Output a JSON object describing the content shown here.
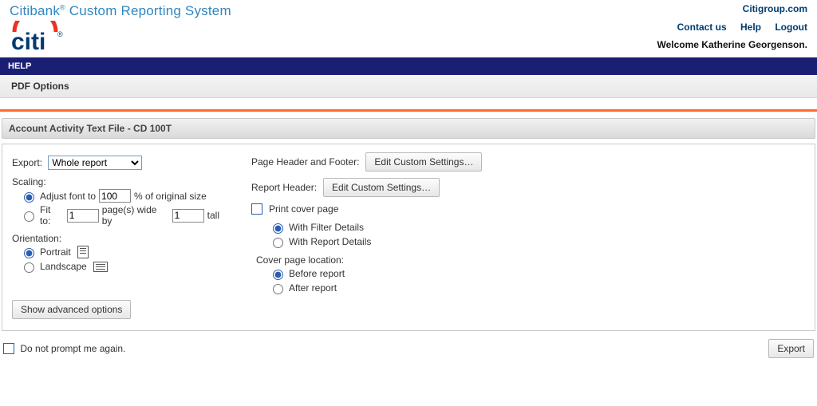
{
  "header": {
    "brand_title_1": "Citibank",
    "brand_reg": "®",
    "brand_title_2": " Custom Reporting System",
    "citi_link": "Citigroup.com",
    "nav_contact": "Contact us",
    "nav_help": "Help",
    "nav_logout": "Logout",
    "welcome": "Welcome Katherine Georgenson."
  },
  "help_bar": "HELP",
  "sub_bar": "PDF Options",
  "section_title": "Account Activity Text File - CD 100T",
  "left": {
    "export_label": "Export:",
    "export_value": "Whole report",
    "scaling_label": "Scaling:",
    "adjust_font_label_pre": "Adjust font to",
    "adjust_font_value": "100",
    "adjust_font_label_post": "% of original size",
    "fit_to_label": "Fit to:",
    "fit_pages_value": "1",
    "fit_pages_mid": "page(s) wide by",
    "fit_tall_value": "1",
    "fit_tall_post": "tall",
    "orientation_label": "Orientation:",
    "portrait_label": "Portrait",
    "landscape_label": "Landscape",
    "show_advanced": "Show advanced options"
  },
  "right": {
    "phf_label": "Page Header and Footer:",
    "edit_custom": "Edit Custom Settings…",
    "rh_label": "Report Header:",
    "print_cover": "Print cover page",
    "with_filter": "With Filter Details",
    "with_report": "With Report Details",
    "cover_loc_label": "Cover page location:",
    "before_report": "Before report",
    "after_report": "After report"
  },
  "footer": {
    "no_prompt": "Do not prompt me again.",
    "export_btn": "Export"
  }
}
